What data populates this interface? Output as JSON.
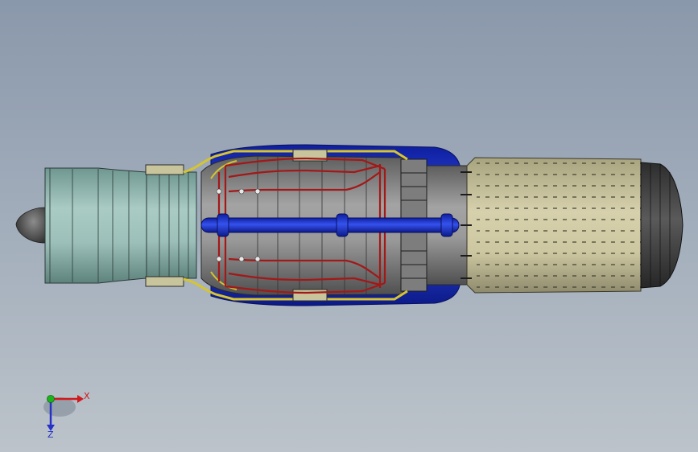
{
  "viewport": {
    "background_top": "#8a98ab",
    "background_bottom": "#bcc3ca"
  },
  "model": {
    "parts": [
      {
        "name": "nose-cone",
        "color": "#5b5b5b"
      },
      {
        "name": "intake-casing",
        "color": "#8fb5ae"
      },
      {
        "name": "compressor-casing",
        "color": "#92b2ac"
      },
      {
        "name": "combustion-casing",
        "color": "#8c8c8c"
      },
      {
        "name": "outer-shroud",
        "color": "#1a2fd0"
      },
      {
        "name": "fuel-lines",
        "color": "#a31818"
      },
      {
        "name": "yellow-harness",
        "color": "#d6c430"
      },
      {
        "name": "center-shaft",
        "color": "#1f3fd4"
      },
      {
        "name": "exhaust-nozzle",
        "color": "#c9c29c"
      },
      {
        "name": "exhaust-cap",
        "color": "#444444"
      }
    ]
  },
  "triad": {
    "x_label": "X",
    "z_label": "Z",
    "x_color": "#d0191b",
    "z_color": "#2531c7",
    "y_color": "#1db31d"
  }
}
